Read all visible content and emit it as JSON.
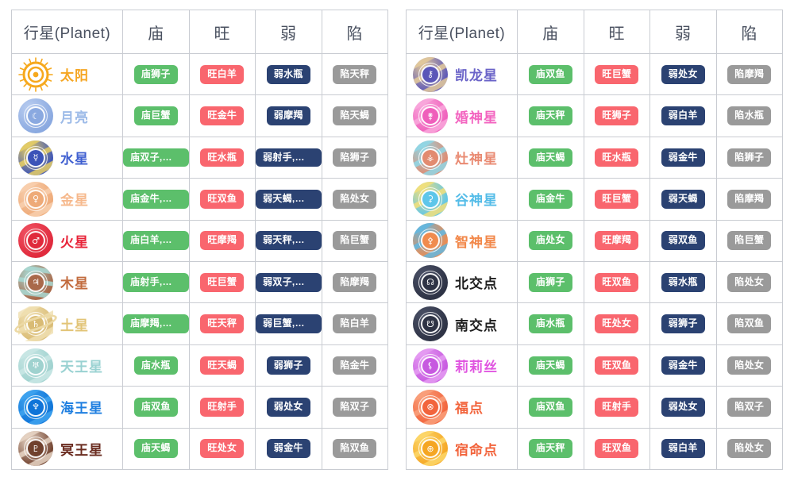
{
  "columns": {
    "planet": "行星(Planet)",
    "miao": "庙",
    "wang": "旺",
    "ruo": "弱",
    "xian": "陷"
  },
  "badge_colors": {
    "miao": "#5cbf6b",
    "wang": "#f9666e",
    "ruo": "#2b4272",
    "xian": "#9a9a9a"
  },
  "left_table": {
    "rows": [
      {
        "name": "太阳",
        "icon": "sun-icon",
        "symbol": "☉",
        "name_color": "#f5a623",
        "icon_colors": {
          "base": "#f6a81c",
          "alt": "#ffc24d"
        },
        "miao": "庙狮子",
        "wang": "旺白羊",
        "ruo": "弱水瓶",
        "xian": "陷天秤"
      },
      {
        "name": "月亮",
        "icon": "moon-icon",
        "symbol": "☾",
        "name_color": "#9dbbe8",
        "icon_colors": {
          "base": "#8aa9e0",
          "alt": "#b9cdf0"
        },
        "miao": "庙巨蟹",
        "wang": "旺金牛",
        "ruo": "弱摩羯",
        "xian": "陷天蝎"
      },
      {
        "name": "水星",
        "icon": "mercury-icon",
        "symbol": "☿",
        "name_color": "#3f5fd0",
        "icon_colors": {
          "base": "#3b53b8",
          "alt": "#e8cf63"
        },
        "miao": "庙双子,处女",
        "wang": "旺水瓶",
        "ruo": "弱射手,双鱼",
        "xian": "陷狮子"
      },
      {
        "name": "金星",
        "icon": "venus-icon",
        "symbol": "♀",
        "name_color": "#f6b98d",
        "icon_colors": {
          "base": "#eeaa78",
          "alt": "#f8cfae"
        },
        "miao": "庙金牛,天秤",
        "wang": "旺双鱼",
        "ruo": "弱天蝎,白羊",
        "xian": "陷处女"
      },
      {
        "name": "火星",
        "icon": "mars-icon",
        "symbol": "♂",
        "name_color": "#e8253a",
        "icon_colors": {
          "base": "#e02a3c",
          "alt": "#f05263"
        },
        "miao": "庙白羊,天蝎",
        "wang": "旺摩羯",
        "ruo": "弱天秤,金牛",
        "xian": "陷巨蟹"
      },
      {
        "name": "木星",
        "icon": "jupiter-icon",
        "symbol": "♃",
        "name_color": "#c26b3e",
        "icon_colors": {
          "base": "#a9694a",
          "alt": "#a8dad4"
        },
        "miao": "庙射手,双鱼",
        "wang": "旺巨蟹",
        "ruo": "弱双子,处女",
        "xian": "陷摩羯"
      },
      {
        "name": "土星",
        "icon": "saturn-icon",
        "symbol": "♄",
        "name_color": "#e2c477",
        "icon_colors": {
          "base": "#d9bb74",
          "alt": "#f0e0b2"
        },
        "miao": "庙摩羯,水瓶",
        "wang": "旺天秤",
        "ruo": "弱巨蟹,狮子",
        "xian": "陷白羊"
      },
      {
        "name": "天王星",
        "icon": "uranus-icon",
        "symbol": "♅",
        "name_color": "#9ad2d2",
        "icon_colors": {
          "base": "#9fd2cf",
          "alt": "#c9e7e5"
        },
        "miao": "庙水瓶",
        "wang": "旺天蝎",
        "ruo": "弱狮子",
        "xian": "陷金牛"
      },
      {
        "name": "海王星",
        "icon": "neptune-icon",
        "symbol": "♆",
        "name_color": "#1f7fe0",
        "icon_colors": {
          "base": "#0f74d8",
          "alt": "#3ea3ef"
        },
        "miao": "庙双鱼",
        "wang": "旺射手",
        "ruo": "弱处女",
        "xian": "陷双子"
      },
      {
        "name": "冥王星",
        "icon": "pluto-icon",
        "symbol": "♇",
        "name_color": "#6b2d21",
        "icon_colors": {
          "base": "#70412e",
          "alt": "#e8d6c6"
        },
        "miao": "庙天蝎",
        "wang": "旺处女",
        "ruo": "弱金牛",
        "xian": "陷双鱼"
      }
    ]
  },
  "right_table": {
    "rows": [
      {
        "name": "凯龙星",
        "icon": "chiron-icon",
        "symbol": "⚷",
        "name_color": "#6a63c8",
        "icon_colors": {
          "base": "#5b56b8",
          "alt": "#e5cb9a"
        },
        "miao": "庙双鱼",
        "wang": "旺巨蟹",
        "ruo": "弱处女",
        "xian": "陷摩羯"
      },
      {
        "name": "婚神星",
        "icon": "juno-icon",
        "symbol": "⚵",
        "name_color": "#f364c0",
        "icon_colors": {
          "base": "#ef5fbb",
          "alt": "#f9a8dc"
        },
        "miao": "庙天秤",
        "wang": "旺狮子",
        "ruo": "弱白羊",
        "xian": "陷水瓶"
      },
      {
        "name": "灶神星",
        "icon": "vesta-icon",
        "symbol": "⚶",
        "name_color": "#e98a72",
        "icon_colors": {
          "base": "#e28b70",
          "alt": "#8fd8e8"
        },
        "miao": "庙天蝎",
        "wang": "旺水瓶",
        "ruo": "弱金牛",
        "xian": "陷狮子"
      },
      {
        "name": "谷神星",
        "icon": "ceres-icon",
        "symbol": "⚳",
        "name_color": "#54bce8",
        "icon_colors": {
          "base": "#5ec6ea",
          "alt": "#f4e07a"
        },
        "miao": "庙金牛",
        "wang": "旺巨蟹",
        "ruo": "弱天蝎",
        "xian": "陷摩羯"
      },
      {
        "name": "智神星",
        "icon": "pallas-icon",
        "symbol": "⚴",
        "name_color": "#f2884a",
        "icon_colors": {
          "base": "#f08b4e",
          "alt": "#61b8e2"
        },
        "miao": "庙处女",
        "wang": "旺摩羯",
        "ruo": "弱双鱼",
        "xian": "陷巨蟹"
      },
      {
        "name": "北交点",
        "icon": "north-node-icon",
        "symbol": "☊",
        "name_color": "#1f1f1f",
        "icon_colors": {
          "base": "#2e3345",
          "alt": "#4a5066"
        },
        "miao": "庙狮子",
        "wang": "旺双鱼",
        "ruo": "弱水瓶",
        "xian": "陷处女"
      },
      {
        "name": "南交点",
        "icon": "south-node-icon",
        "symbol": "☋",
        "name_color": "#1f1f1f",
        "icon_colors": {
          "base": "#2e3345",
          "alt": "#4a5066"
        },
        "miao": "庙水瓶",
        "wang": "旺处女",
        "ruo": "弱狮子",
        "xian": "陷双鱼"
      },
      {
        "name": "莉莉丝",
        "icon": "lilith-icon",
        "symbol": "⚸",
        "name_color": "#e055e0",
        "icon_colors": {
          "base": "#c759e0",
          "alt": "#e59cf2"
        },
        "miao": "庙天蝎",
        "wang": "旺双鱼",
        "ruo": "弱金牛",
        "xian": "陷处女"
      },
      {
        "name": "福点",
        "icon": "part-of-fortune-icon",
        "symbol": "⊗",
        "name_color": "#f2643c",
        "icon_colors": {
          "base": "#f2643c",
          "alt": "#f9a07c"
        },
        "miao": "庙双鱼",
        "wang": "旺射手",
        "ruo": "弱处女",
        "xian": "陷双子"
      },
      {
        "name": "宿命点",
        "icon": "vertex-icon",
        "symbol": "⊕",
        "name_color": "#f2643c",
        "icon_colors": {
          "base": "#f5a623",
          "alt": "#fcd76a"
        },
        "miao": "庙天秤",
        "wang": "旺双鱼",
        "ruo": "弱白羊",
        "xian": "陷处女"
      }
    ]
  }
}
